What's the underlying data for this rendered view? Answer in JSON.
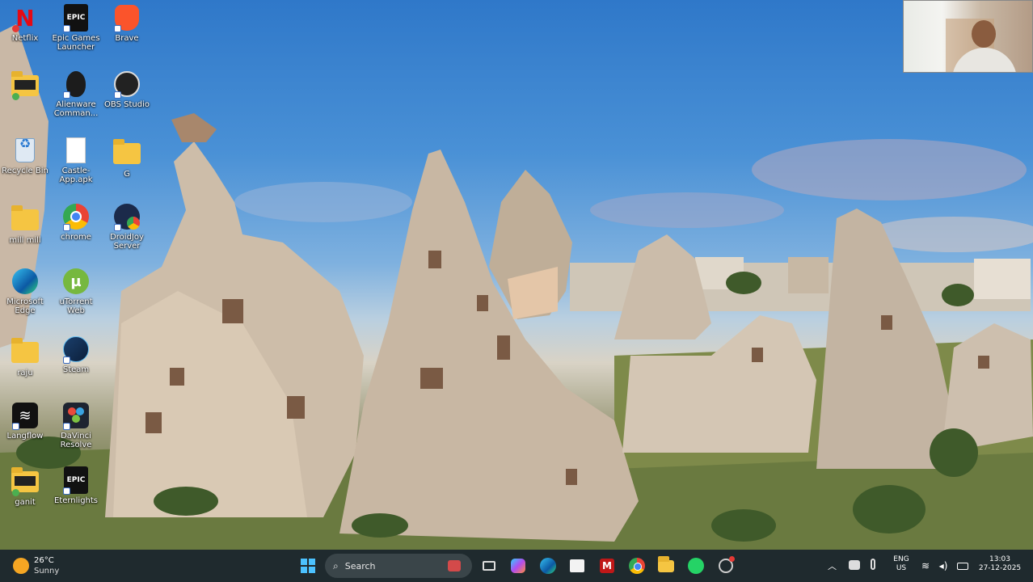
{
  "desktop": {
    "icons": [
      {
        "label": "Netflix",
        "icon": "netflix-icon"
      },
      {
        "label": "Epic Games Launcher",
        "icon": "epic-games-icon"
      },
      {
        "label": "Brave",
        "icon": "brave-icon"
      },
      {
        "label": "",
        "icon": "folder-icon"
      },
      {
        "label": "Alienware Comman...",
        "icon": "alienware-icon"
      },
      {
        "label": "OBS Studio",
        "icon": "obs-icon"
      },
      {
        "label": "Recycle Bin",
        "icon": "recycle-bin-icon"
      },
      {
        "label": "Castle-App.apk",
        "icon": "file-icon"
      },
      {
        "label": "G",
        "icon": "folder-icon"
      },
      {
        "label": "mill mill",
        "icon": "folder-icon"
      },
      {
        "label": "chrome",
        "icon": "chrome-icon"
      },
      {
        "label": "DroidJoy Server",
        "icon": "droidjoy-icon"
      },
      {
        "label": "Microsoft Edge",
        "icon": "edge-icon"
      },
      {
        "label": "uTorrent Web",
        "icon": "utorrent-icon"
      },
      {
        "label": "raju",
        "icon": "folder-icon"
      },
      {
        "label": "Steam",
        "icon": "steam-icon"
      },
      {
        "label": "Langflow",
        "icon": "langflow-icon"
      },
      {
        "label": "DaVinci Resolve",
        "icon": "davinci-icon"
      },
      {
        "label": "ganit",
        "icon": "folder-icon"
      },
      {
        "label": "Eternlights",
        "icon": "epic-games-icon"
      }
    ]
  },
  "taskbar": {
    "weather": {
      "temp": "26°C",
      "condition": "Sunny"
    },
    "search_label": "Search",
    "language": {
      "line1": "ENG",
      "line2": "US"
    },
    "clock": {
      "time": "13:03",
      "date": "27-12-2025"
    },
    "pinned": [
      "task-view-icon",
      "copilot-icon",
      "edge-icon",
      "store-icon",
      "mcafee-icon",
      "chrome-icon",
      "file-explorer-icon",
      "whatsapp-icon",
      "settings-icon"
    ]
  },
  "colors": {
    "taskbar_bg": "#1f2a2e",
    "search_bg": "#3a4549",
    "folder": "#f5c542",
    "sky": "#3d86d0"
  }
}
